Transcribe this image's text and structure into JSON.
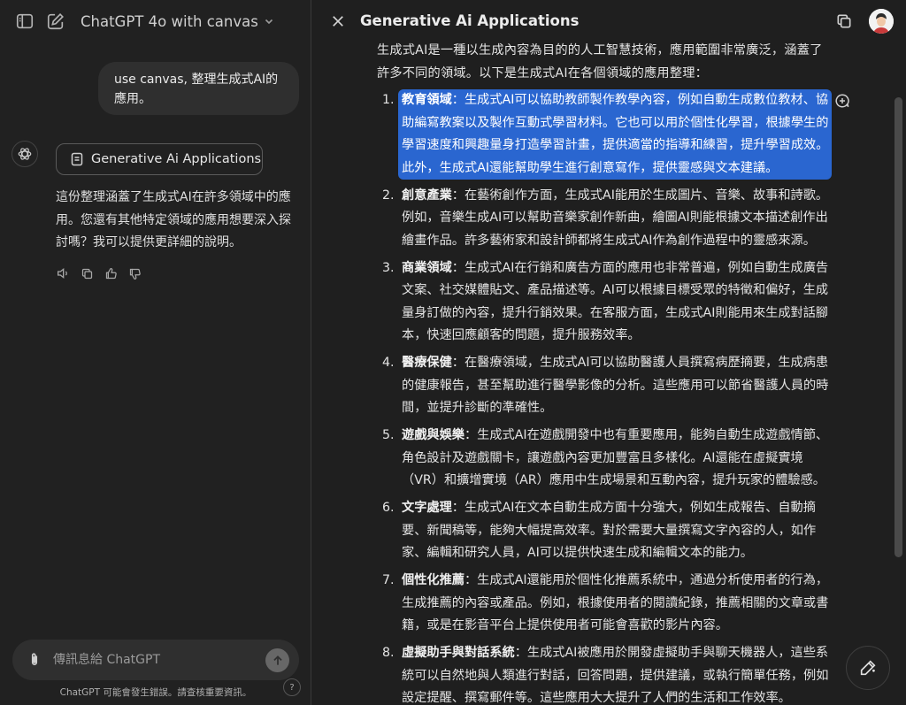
{
  "chat": {
    "model_name": "ChatGPT 4o with canvas",
    "user_message": "use canvas, 整理生成式AI的應用。",
    "canvas_card_label": "Generative Ai Applications",
    "assistant_message": "這份整理涵蓋了生成式AI在許多領域中的應用。您還有其他特定領域的應用想要深入探討嗎？我可以提供更詳細的說明。",
    "composer_placeholder": "傳訊息給 ChatGPT",
    "disclaimer": "ChatGPT 可能會發生錯誤。請查核重要資訊。",
    "help_label": "?"
  },
  "canvas": {
    "title": "Generative Ai Applications",
    "intro": "生成式AI是一種以生成內容為目的的人工智慧技術，應用範圍非常廣泛，涵蓋了許多不同的領域。以下是生成式AI在各個領域的應用整理：",
    "items": [
      {
        "num": "1.",
        "title": "教育領域",
        "text": "：生成式AI可以協助教師製作教學內容，例如自動生成數位教材、協助編寫教案以及製作互動式學習材料。它也可以用於個性化學習，根據學生的學習速度和興趣量身打造學習計畫，提供適當的指導和練習，提升學習成效。此外，生成式AI還能幫助學生進行創意寫作，提供靈感與文本建議。"
      },
      {
        "num": "2.",
        "title": "創意產業",
        "text": "：在藝術創作方面，生成式AI能用於生成圖片、音樂、故事和詩歌。例如，音樂生成AI可以幫助音樂家創作新曲，繪圖AI則能根據文本描述創作出繪畫作品。許多藝術家和設計師都將生成式AI作為創作過程中的靈感來源。"
      },
      {
        "num": "3.",
        "title": "商業領域",
        "text": "：生成式AI在行銷和廣告方面的應用也非常普遍，例如自動生成廣告文案、社交媒體貼文、產品描述等。AI可以根據目標受眾的特徵和偏好，生成量身訂做的內容，提升行銷效果。在客服方面，生成式AI則能用來生成對話腳本，快速回應顧客的問題，提升服務效率。"
      },
      {
        "num": "4.",
        "title": "醫療保健",
        "text": "：在醫療領域，生成式AI可以協助醫護人員撰寫病歷摘要，生成病患的健康報告，甚至幫助進行醫學影像的分析。這些應用可以節省醫護人員的時間，並提升診斷的準確性。"
      },
      {
        "num": "5.",
        "title": "遊戲與娛樂",
        "text": "：生成式AI在遊戲開發中也有重要應用，能夠自動生成遊戲情節、角色設計及遊戲關卡，讓遊戲內容更加豐富且多樣化。AI還能在虛擬實境（VR）和擴增實境（AR）應用中生成場景和互動內容，提升玩家的體驗感。"
      },
      {
        "num": "6.",
        "title": "文字處理",
        "text": "：生成式AI在文本自動生成方面十分強大，例如生成報告、自動摘要、新聞稿等，能夠大幅提高效率。對於需要大量撰寫文字內容的人，如作家、編輯和研究人員，AI可以提供快速生成和編輯文本的能力。"
      },
      {
        "num": "7.",
        "title": "個性化推薦",
        "text": "：生成式AI還能用於個性化推薦系統中，通過分析使用者的行為，生成推薦的內容或產品。例如，根據使用者的閱讀紀錄，推薦相關的文章或書籍，或是在影音平台上提供使用者可能會喜歡的影片內容。"
      },
      {
        "num": "8.",
        "title": "虛擬助手與對話系統",
        "text": "：生成式AI被應用於開發虛擬助手與聊天機器人，這些系統可以自然地與人類進行對話，回答問題，提供建議，或執行簡單任務，例如設定提醒、撰寫郵件等。這些應用大大提升了人們的生活和工作效率。"
      }
    ]
  },
  "colors": {
    "selection": "#2a66d0",
    "background": "#212121"
  },
  "icons": [
    "sidebar-toggle-icon",
    "new-chat-icon",
    "chevron-down-icon",
    "chatgpt-logo-icon",
    "document-icon",
    "speaker-icon",
    "copy-icon",
    "thumbs-up-icon",
    "thumbs-down-icon",
    "paperclip-icon",
    "arrow-up-icon",
    "close-icon",
    "add-comment-icon",
    "edit-pencil-icon"
  ]
}
